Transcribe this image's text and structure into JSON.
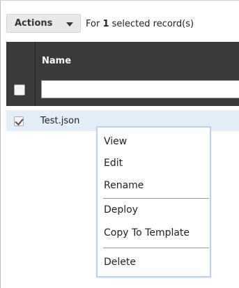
{
  "toolbar": {
    "actions_label": "Actions",
    "selection_prefix": "For ",
    "selection_count": "1",
    "selection_suffix": " selected record(s)"
  },
  "table": {
    "columns": [
      "Name"
    ],
    "filter_value": "",
    "rows": [
      {
        "name": "Test.json",
        "checked": true
      }
    ]
  },
  "context_menu": {
    "items": [
      "View",
      "Edit",
      "Rename",
      "Deploy",
      "Copy To Template",
      "Delete"
    ]
  },
  "colors": {
    "header_bg": "#3a3a3a",
    "selected_row_bg": "#e4eef9",
    "menu_border": "#b9d2f0"
  },
  "icons": [
    "caret-down-icon",
    "checkmark-icon"
  ]
}
